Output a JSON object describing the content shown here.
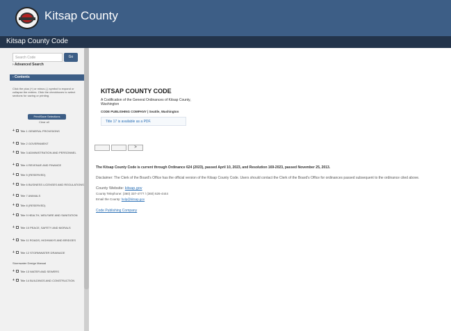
{
  "header": {
    "brand": "Kitsap County",
    "site_title": "Kitsap County Code"
  },
  "sidebar": {
    "search_placeholder": "Search Code",
    "go_label": "Go",
    "advanced_search": "› Advanced Search",
    "contents_label": "- Contents",
    "help_text": "Click the plus (+) or minus (-) symbol to expand or collapse the entries. Click the checkboxes to select sections for saving or printing.",
    "print_button": "Print/Save Selections",
    "clear_all": "Clear all",
    "items": [
      {
        "prefix": "+",
        "label": "Title 1 GENERAL PROVISIONS"
      },
      {
        "prefix": "+",
        "label": "Title 2 GOVERNMENT"
      },
      {
        "prefix": "+",
        "label": "Title 3 ADMINISTRATION AND PERSONNEL"
      },
      {
        "prefix": "+",
        "label": "Title 4 REVENUE AND FINANCE"
      },
      {
        "prefix": "+",
        "label": "Title 5 (RESERVED)"
      },
      {
        "prefix": "+",
        "label": "Title 6 BUSINESS LICENSES AND REGULATIONS"
      },
      {
        "prefix": "+",
        "label": "Title 7 ANIMALS"
      },
      {
        "prefix": "+",
        "label": "Title 8 (RESERVED)"
      },
      {
        "prefix": "+",
        "label": "Title 9 HEALTH, WELFARE AND SANITATION"
      },
      {
        "prefix": "+",
        "label": "Title 10 PEACE, SAFETY AND MORALS"
      },
      {
        "prefix": "+",
        "label": "Title 11 ROADS, HIGHWAYS AND BRIDGES"
      },
      {
        "prefix": "+",
        "label": "Title 12 STORMWATER DRAINAGE"
      },
      {
        "prefix": "",
        "label": "Stormwater Design Manual"
      },
      {
        "prefix": "+",
        "label": "Title 13 WATER AND SEWERS"
      },
      {
        "prefix": "+",
        "label": "Title 14 BUILDINGS AND CONSTRUCTION"
      }
    ]
  },
  "main": {
    "title": "KITSAP COUNTY CODE",
    "certification": "A Codification of the General Ordinances of Kitsap County, Washington",
    "publisher": "CODE PUBLISHING COMPANY | Seattle, Washington",
    "pdf_notice": "Title 17 is available as a PDF.",
    "pager": [
      "",
      "",
      ">"
    ],
    "currency": "The Kitsap County Code is current through Ordinance 624 (2023), passed April 10, 2023, and Resolution 169-2023, passed November 25, 2013.",
    "disclaimer": "Disclaimer: The Clerk of the Board's Office has the official version of the Kitsap County Code. Users should contact the Clerk of the Board's Office for ordinances passed subsequent to the ordinance cited above.",
    "county_website_label": "County Website:",
    "county_website_link": "kitsap.gov",
    "county_telephone": "County Telephone: (360) 337-4777 / (360) 626-4444",
    "email_label": "Email the County:",
    "email_link": "help@kitsap.gov",
    "code_publishing_link": "Code Publishing Company"
  }
}
